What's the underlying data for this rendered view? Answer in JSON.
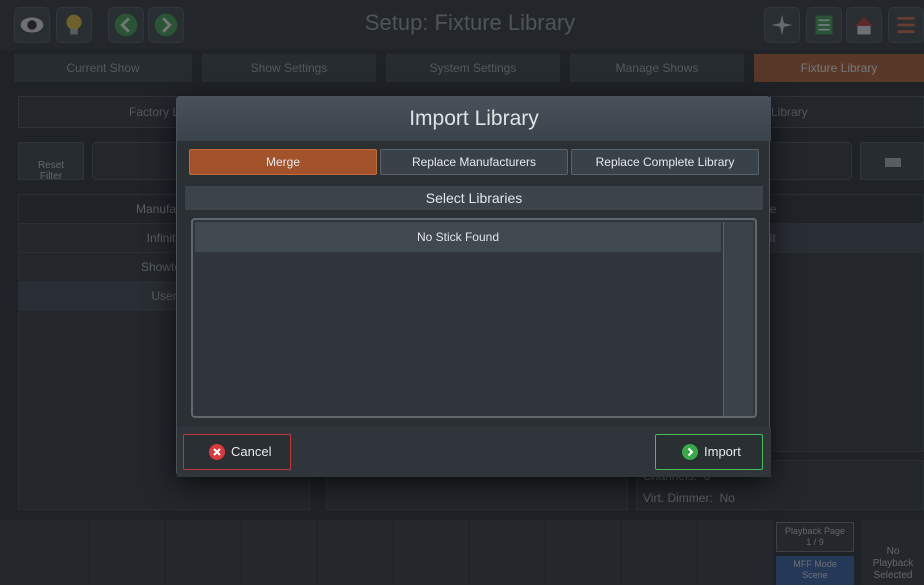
{
  "header": {
    "title": "Setup: Fixture Library"
  },
  "tabs": [
    "Current Show",
    "Show Settings",
    "System Settings",
    "Manage Shows",
    "Fixture Library"
  ],
  "subtabs": {
    "left": "Factory Li",
    "right": "Library"
  },
  "filter": {
    "reset_label": "Reset\nFilter"
  },
  "manufacturers": {
    "header": "Manufactu",
    "items": [
      "Infinity",
      "Showtec",
      "User"
    ]
  },
  "mode_panel": {
    "header": "de",
    "items": [
      "ult"
    ]
  },
  "details": {
    "channels_label": "Channels:",
    "channels_value": "0",
    "virt_dimmer": "Virt. Dimmer:  No"
  },
  "bottom_bar": {
    "playback_page_label": "Playback Page",
    "playback_page_value": "1 / 9",
    "mff_mode_label": "MFF Mode",
    "mff_mode_value": "Scene",
    "no_playback": "No\nPlayback\nSelected"
  },
  "dialog": {
    "title": "Import Library",
    "options": [
      "Merge",
      "Replace Manufacturers",
      "Replace Complete Library"
    ],
    "selected_option": "Merge",
    "section_title": "Select Libraries",
    "list_header": "No Stick Found",
    "cancel_label": "Cancel",
    "import_label": "Import"
  },
  "colors": {
    "accent": "#b85c2c",
    "cancel": "#c2373a",
    "import": "#3fbf55"
  }
}
